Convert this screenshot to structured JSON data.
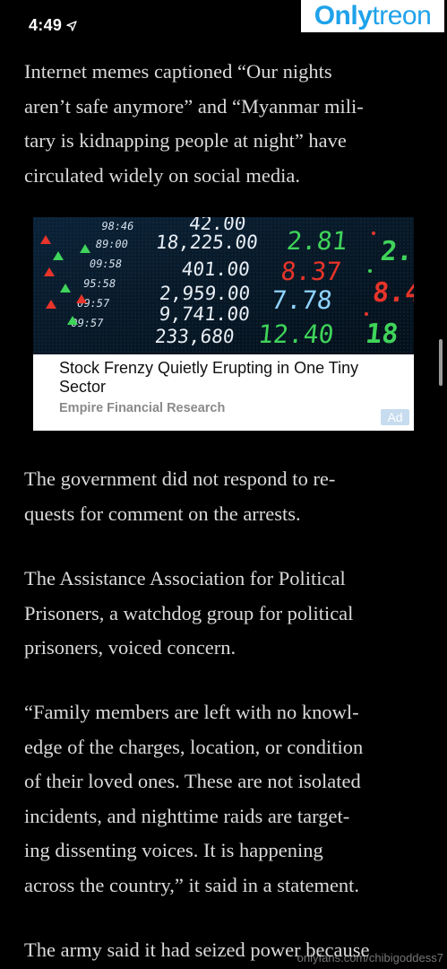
{
  "status_bar": {
    "time": "4:49",
    "location_icon": "location-arrow-icon"
  },
  "watermark": {
    "part1": "Only",
    "part2": "treon",
    "bottom_text": "onlyfans.com/chibigoddess7"
  },
  "article": {
    "paragraphs": [
      "Internet memes captioned “Our nights\naren’t safe anymore” and “Myanmar mili-\ntary is kidnapping people at night” have\ncirculated widely on social media.",
      "The government did not respond to re-\nquests for comment on the arrests.",
      "The Assistance Association for Political\nPrisoners, a watchdog group for political\nprisoners, voiced concern.",
      "“Family members are left with no knowl-\nedge of the charges, location, or condition\nof their loved ones. These are not isolated\nincidents, and nighttime raids are target-\ning dissenting voices. It is happening\nacross the country,” it said in a statement.",
      "The army said it had seized power because"
    ]
  },
  "ad": {
    "headline": "Stock Frenzy Quietly Erupting in One Tiny Sector",
    "sponsor": "Empire Financial Research",
    "badge": "Ad",
    "image_numbers_white": [
      "42.00",
      "18,225.00",
      "401.00",
      "2,959.00",
      "9,741.00",
      "233,680"
    ],
    "image_numbers_green": [
      "2.81",
      "12.40"
    ],
    "image_numbers_red": [
      "8.37"
    ],
    "image_numbers_blue": [
      "7.78"
    ],
    "image_numbers_left": [
      "98:46",
      "89:00",
      "09:58",
      "95:58",
      "09:57",
      "09:57"
    ],
    "image_right_green": "2.",
    "image_right_red": "8.4",
    "image_right_green2": "18",
    "colors": {
      "green": "#3fd45a",
      "red": "#e8342a",
      "blue": "#8fd3ff",
      "white": "#e8eef5"
    }
  }
}
